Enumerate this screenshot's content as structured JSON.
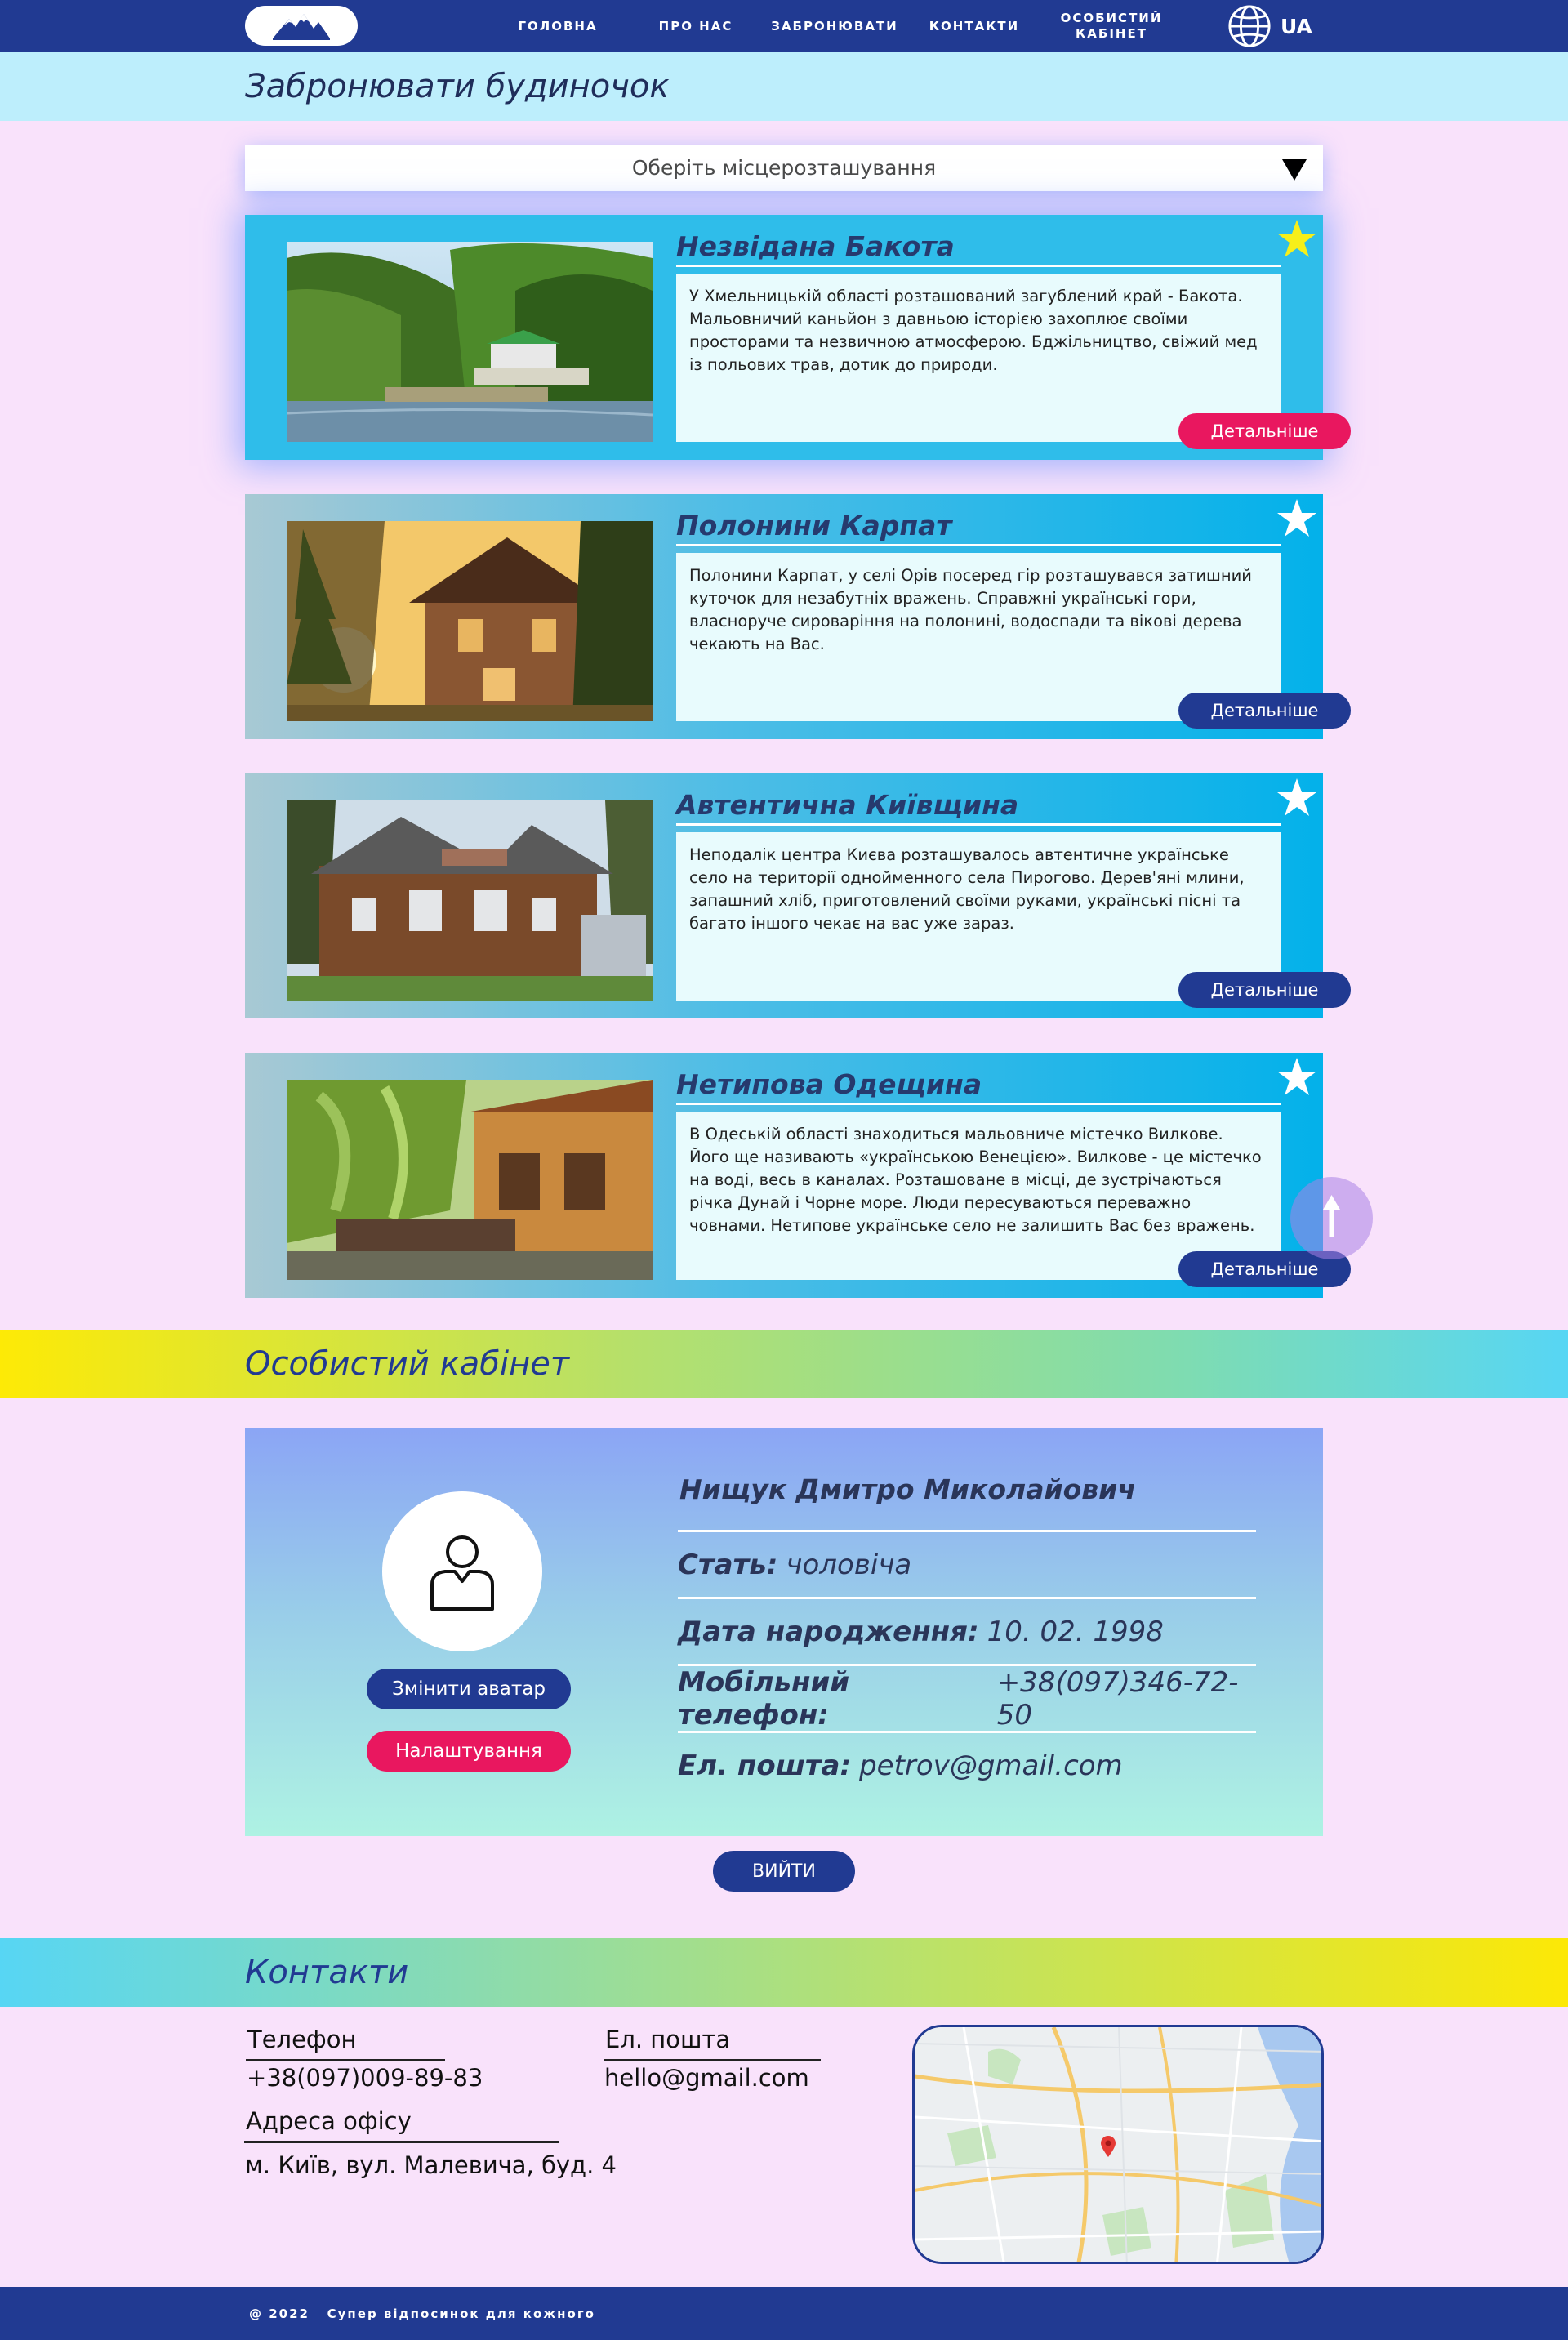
{
  "nav": {
    "items": [
      "ГОЛОВНА",
      "ПРО НАС",
      "ЗАБРОНЮВАТИ",
      "КОНТАКТИ",
      "ОСОБИСТИЙ КАБІНЕТ"
    ],
    "lang": "UA",
    "colors": {
      "background": "#213a92"
    }
  },
  "booking": {
    "heading": "Забронювати будиночок",
    "select_placeholder": "Оберіть місцерозташування",
    "cards": [
      {
        "title": "Незвідана Бакота",
        "description": "У Хмельницькій області розташований загублений край - Бакота. Мальовничий каньйон з давньою історією захоплює своїми просторами та незвичною атмосферою. Бджільництво, свіжий мед із польових трав, дотик до природи.",
        "button": "Детальніше",
        "favorite": true,
        "image": "valley-river-monastery-photo"
      },
      {
        "title": "Полонини Карпат",
        "description": "Полонини Карпат, у селі Орів посеред гір розташувався затишний куточок для незабутніх вражень. Справжні українські гори, власноруче сироваріння на полонині, водоспади та вікові дерева чекають на Вас.",
        "button": "Детальніше",
        "favorite": false,
        "image": "wooden-house-sunset-photo"
      },
      {
        "title": "Автентична Київщина",
        "description": "Неподалік центра Києва розташувалось автентичне українське село на території однойменного села Пирогово. Дерев'яні млини, запашний хліб, приготовлений своїми руками, українські пісні та багато іншого чекає на вас уже зараз.",
        "button": "Детальніше",
        "favorite": false,
        "image": "log-house-photo"
      },
      {
        "title": "Нетипова Одещина",
        "description": "В Одеській області знаходиться мальовниче містечко Вилкове. Його ще називають «українською Венецією». Вилкове - це містечко на воді, весь в каналах. Розташоване в місці, де зустрічаються річка Дунай і Чорне море. Люди пересуваються переважно човнами. Нетипове українське село не залишить Вас без вражень.",
        "button": "Детальніше",
        "favorite": false,
        "image": "willow-terrace-photo"
      }
    ],
    "colors": {
      "heading_band": "#bdeefc",
      "favorite_star": "#f6ef1a",
      "primary_button": "#213a92",
      "accent_button": "#e9175f"
    }
  },
  "profile": {
    "heading": "Особистий кабінет",
    "name": "Нищук Дмитро Миколайович",
    "fields": [
      {
        "label": "Стать:",
        "value": "чоловіча"
      },
      {
        "label": "Дата народження:",
        "value": "10. 02. 1998"
      },
      {
        "label": "Мобільний телефон:",
        "value": "+38(097)346-72-50"
      },
      {
        "label": "Ел. пошта:",
        "value": "petrov@gmail.com"
      }
    ],
    "change_avatar": "Змінити аватар",
    "settings": "Налаштування",
    "logout": "ВИЙТИ"
  },
  "contacts": {
    "heading": "Контакти",
    "phone_label": "Телефон",
    "phone": "+38(097)009-89-83",
    "email_label": "Ел. пошта",
    "email": "hello@gmail.com",
    "address_label": "Адреса офісу",
    "address": "м. Київ, вул. Малевича, буд. 4"
  },
  "footer": {
    "text": "@ 2022   Супер відпосинок для кожного"
  }
}
